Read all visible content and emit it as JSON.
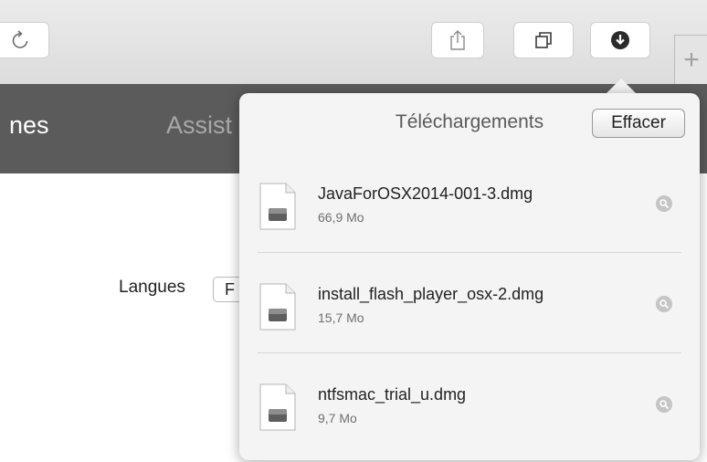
{
  "nav": {
    "item_1": "nes",
    "item_2": "Assist"
  },
  "settings": {
    "language_label": "Langues",
    "language_value": "F"
  },
  "toolbar": {
    "icons": [
      "reload-icon",
      "share-icon",
      "tabs-icon",
      "downloads-icon",
      "new-tab-icon"
    ],
    "new_tab_glyph": "+"
  },
  "downloads": {
    "title": "Téléchargements",
    "clear_label": "Effacer",
    "items": [
      {
        "name": "JavaForOSX2014-001-3.dmg",
        "size": "66,9 Mo"
      },
      {
        "name": "install_flash_player_osx-2.dmg",
        "size": "15,7 Mo"
      },
      {
        "name": "ntfsmac_trial_u.dmg",
        "size": "9,7 Mo"
      }
    ]
  },
  "colors": {
    "navbar": "#5b5b5b",
    "popover": "#f4f4f4",
    "toolbar": "#e4e4e4"
  }
}
